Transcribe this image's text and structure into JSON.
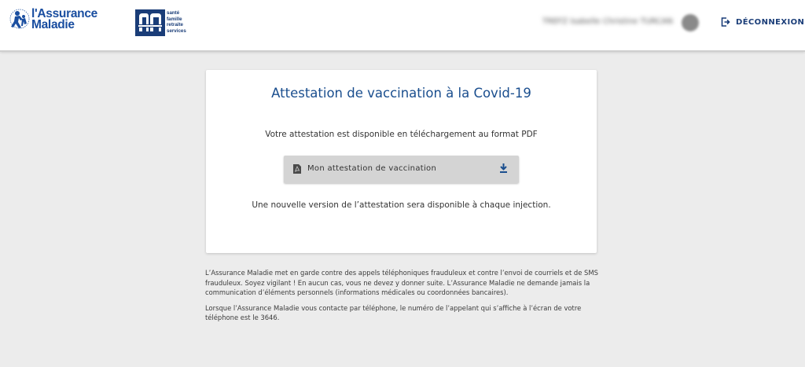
{
  "header": {
    "logo_assurance_maladie": "l'Assurance Maladie",
    "logo_msa": {
      "lines": [
        "santé",
        "famille",
        "retraite",
        "services"
      ]
    },
    "user": {
      "name": "TREFZ Isabelle Christine TURCAN"
    },
    "logout_label": "DÉCONNEXION"
  },
  "card": {
    "title": "Attestation de vaccination à la Covid-19",
    "intro": "Votre attestation est disponible en téléchargement au format PDF",
    "download_button_label": "Mon attestation de vaccination",
    "note": "Une nouvelle version de l’attestation sera disponible à chaque injection."
  },
  "warning": {
    "paragraph1": "L’Assurance Maladie met en garde contre des appels téléphoniques frauduleux et contre l’envoi de courriels et de SMS frauduleux. Soyez vigilant ! En aucun cas, vous ne devez y donner suite. L’Assurance Maladie ne demande jamais la communication d’éléments personnels (informations médicales ou coordonnées bancaires).",
    "paragraph2": "Lorsque l’Assurance Maladie vous contacte par téléphone, le numéro de l’appelant qui s’affiche à l’écran de votre téléphone est le 3646."
  },
  "colors": {
    "brand_blue": "#1a4e8e",
    "logout_blue": "#1a3d78",
    "page_background": "#ececec",
    "button_background": "#d4d4d4"
  },
  "icons": [
    "assurance-maladie-logo",
    "msa-logo",
    "avatar",
    "logout-icon",
    "pdf-icon",
    "download-icon"
  ]
}
